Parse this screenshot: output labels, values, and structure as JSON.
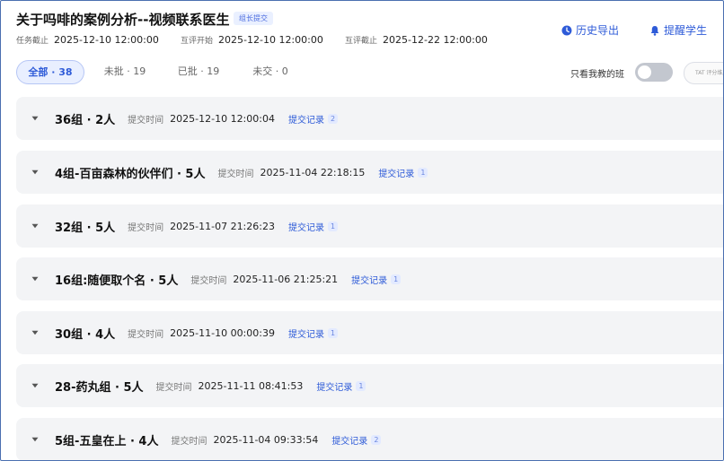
{
  "header": {
    "title": "关于吗啡的案例分析--视频联系医生",
    "tag": "组长提交",
    "actions": [
      {
        "label": "历史导出",
        "icon": "clock-icon"
      },
      {
        "label": "提醒学生",
        "icon": "bell-icon"
      }
    ],
    "meta": [
      {
        "label": "任务截止",
        "value": "2025-12-10 12:00:00"
      },
      {
        "label": "互评开始",
        "value": "2025-12-10 12:00:00"
      },
      {
        "label": "互评截止",
        "value": "2025-12-22 12:00:00"
      }
    ]
  },
  "tabs": [
    {
      "label": "全部 · 38",
      "active": true
    },
    {
      "label": "未批 · 19",
      "active": false
    },
    {
      "label": "已批 · 19",
      "active": false
    },
    {
      "label": "未交 · 0",
      "active": false
    }
  ],
  "filter": {
    "toggle_label": "只看我教的班",
    "toggle_on": false,
    "cut_button": "TAT 评分维度"
  },
  "submit_label": "提交时间",
  "record_label": "提交记录",
  "groups": [
    {
      "name": "36组 · 2人",
      "time": "2025-12-10 12:00:04",
      "records": "2"
    },
    {
      "name": "4组-百亩森林的伙伴们 · 5人",
      "time": "2025-11-04 22:18:15",
      "records": "1"
    },
    {
      "name": "32组 · 5人",
      "time": "2025-11-07 21:26:23",
      "records": "1"
    },
    {
      "name": "16组:随便取个名 · 5人",
      "time": "2025-11-06 21:25:21",
      "records": "1"
    },
    {
      "name": "30组 · 4人",
      "time": "2025-11-10 00:00:39",
      "records": "1"
    },
    {
      "name": "28-药丸组 · 5人",
      "time": "2025-11-11 08:41:53",
      "records": "1"
    },
    {
      "name": "5组-五皇在上 · 4人",
      "time": "2025-11-04 09:33:54",
      "records": "2"
    }
  ],
  "colors": {
    "accent": "#2e5bd8",
    "row_bg": "#f3f4f6",
    "frame_border": "#4a6fb0"
  }
}
